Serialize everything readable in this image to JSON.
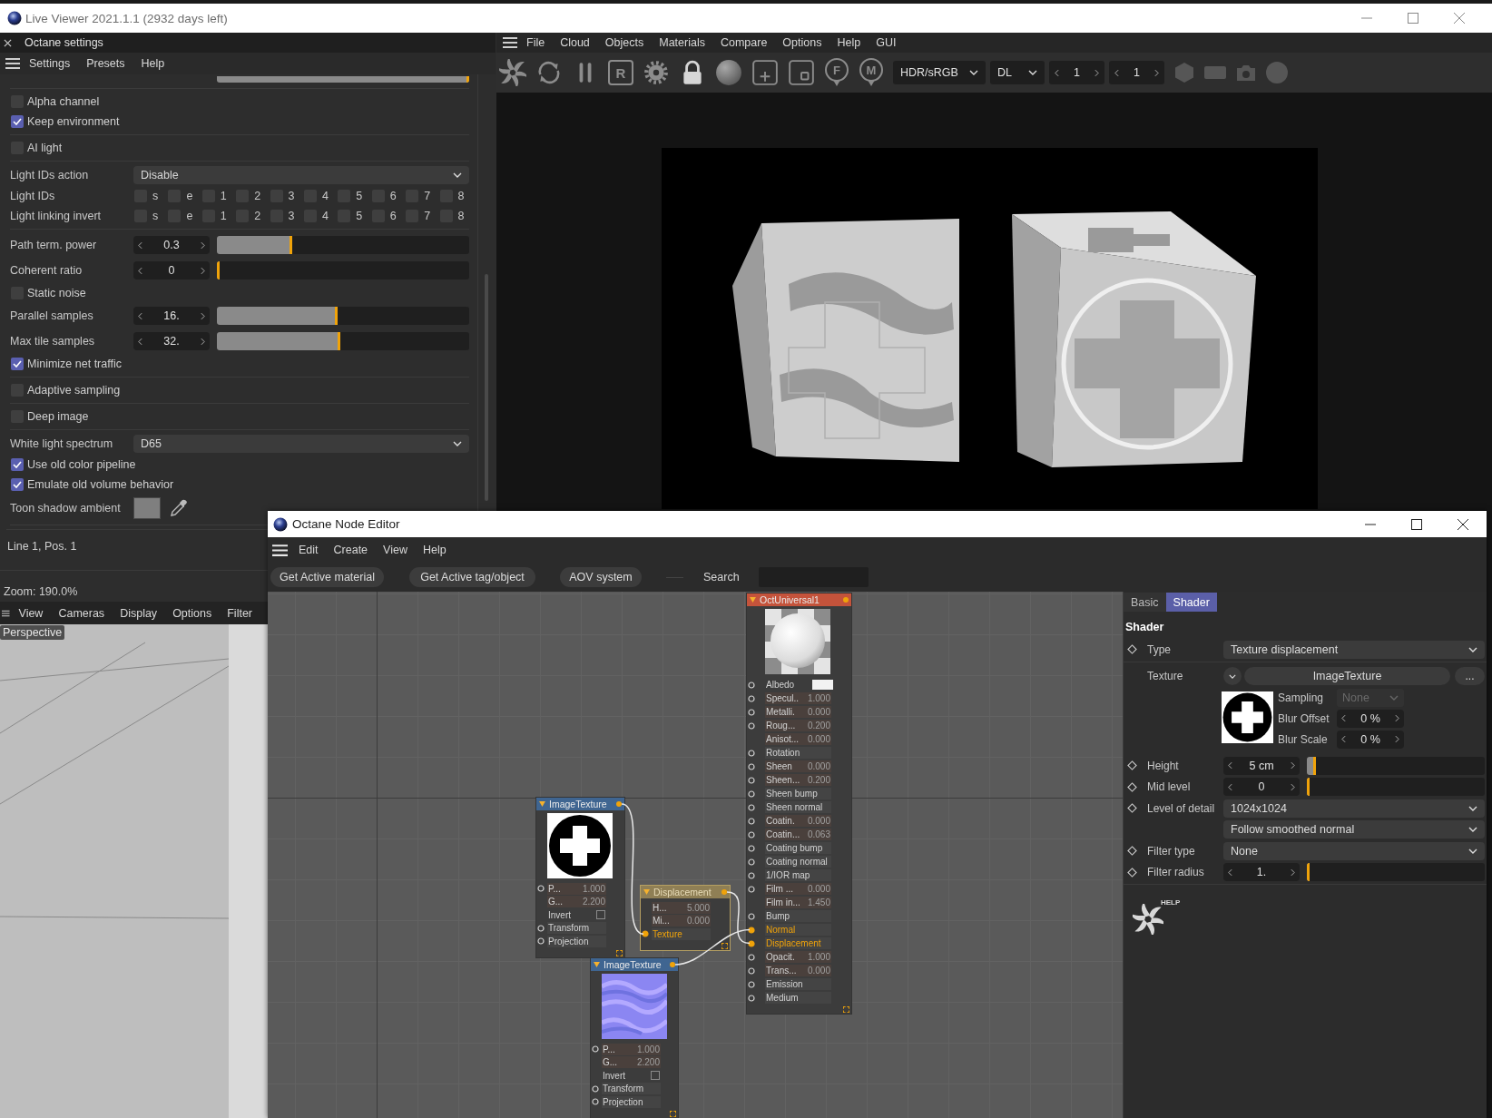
{
  "window": {
    "title": "Live Viewer 2021.1.1 (2932 days left)"
  },
  "settings": {
    "title": "Octane settings",
    "menu": [
      "Settings",
      "Presets",
      "Help"
    ],
    "partial_slider": {
      "level": 1
    },
    "groups": [
      [
        {
          "kind": "checkbox",
          "label": "Alpha channel",
          "checked": false
        },
        {
          "kind": "checkbox",
          "label": "Keep environment",
          "checked": true
        }
      ],
      [
        {
          "kind": "checkbox",
          "label": "AI light",
          "checked": false
        }
      ],
      [
        {
          "kind": "dropdown",
          "label": "Light IDs action",
          "value": "Disable"
        },
        {
          "kind": "checkgrid",
          "label": "Light IDs",
          "boxes": [
            {
              "label": "s",
              "checked": false
            },
            {
              "label": "e",
              "checked": false
            },
            {
              "label": "1",
              "checked": false
            },
            {
              "label": "2",
              "checked": false
            },
            {
              "label": "3",
              "checked": false
            },
            {
              "label": "4",
              "checked": false
            },
            {
              "label": "5",
              "checked": false
            },
            {
              "label": "6",
              "checked": false
            },
            {
              "label": "7",
              "checked": false
            },
            {
              "label": "8",
              "checked": false
            }
          ]
        },
        {
          "kind": "checkgrid",
          "label": "Light linking invert",
          "boxes": [
            {
              "label": "s",
              "checked": false
            },
            {
              "label": "e",
              "checked": false
            },
            {
              "label": "1",
              "checked": false
            },
            {
              "label": "2",
              "checked": false
            },
            {
              "label": "3",
              "checked": false
            },
            {
              "label": "4",
              "checked": false
            },
            {
              "label": "5",
              "checked": false
            },
            {
              "label": "6",
              "checked": false
            },
            {
              "label": "7",
              "checked": false
            },
            {
              "label": "8",
              "checked": false
            }
          ]
        }
      ],
      [
        {
          "kind": "slider",
          "label": "Path term. power",
          "value": "0.3",
          "level": 0.3
        },
        {
          "kind": "slider",
          "label": "Coherent ratio",
          "value": "0",
          "level": 0
        },
        {
          "kind": "checkbox",
          "label": "Static noise",
          "checked": false
        },
        {
          "kind": "slider",
          "label": "Parallel samples",
          "value": "16.",
          "level": 0.48
        },
        {
          "kind": "slider",
          "label": "Max tile samples",
          "value": "32.",
          "level": 0.49
        },
        {
          "kind": "checkbox",
          "label": "Minimize net traffic",
          "checked": true
        }
      ],
      [
        {
          "kind": "checkbox",
          "label": "Adaptive sampling",
          "checked": false
        }
      ],
      [
        {
          "kind": "checkbox",
          "label": "Deep image",
          "checked": false
        }
      ],
      [
        {
          "kind": "dropdown",
          "label": "White light spectrum",
          "value": "D65"
        },
        {
          "kind": "checkbox",
          "label": "Use old color pipeline",
          "checked": true
        },
        {
          "kind": "checkbox",
          "label": "Emulate old volume behavior",
          "checked": true
        },
        {
          "kind": "color",
          "label": "Toon shadow ambient",
          "color": "#7f7f7f"
        }
      ]
    ],
    "status": "Line 1, Pos. 1",
    "zoom": "Zoom: 190.0%"
  },
  "viewport": {
    "menu": [
      "View",
      "Cameras",
      "Display",
      "Options",
      "Filter"
    ],
    "label": "Perspective"
  },
  "viewer": {
    "menu": [
      "File",
      "Cloud",
      "Objects",
      "Materials",
      "Compare",
      "Options",
      "Help",
      "GUI"
    ],
    "toolbar": {
      "letter_key": "R",
      "pins": [
        "F",
        "M"
      ],
      "dropdowns": [
        "HDR/sRGB",
        "DL"
      ],
      "spinners": [
        "1",
        "1"
      ]
    }
  },
  "node_editor": {
    "title": "Octane Node Editor",
    "menu": [
      "Edit",
      "Create",
      "View",
      "Help"
    ],
    "buttons": [
      "Get Active material",
      "Get Active tag/object",
      "AOV system"
    ],
    "search_label": "Search",
    "nodes": [
      {
        "kind": "material",
        "title": "OctUniversal1",
        "preview": {
          "kind": "material_ball"
        },
        "selected": false,
        "rows": [
          {
            "kind": "color",
            "label": "Albedo",
            "port": true,
            "connected": false,
            "color": "#f2f2f2"
          },
          {
            "kind": "value",
            "label": "Specul..",
            "value": "1.000",
            "port": true,
            "connected": false
          },
          {
            "kind": "value",
            "label": "Metalli.",
            "value": "0.000",
            "port": true,
            "connected": false
          },
          {
            "kind": "value",
            "label": "Roug...",
            "value": "0.200",
            "port": true,
            "connected": false
          },
          {
            "kind": "value",
            "label": "Anisot...",
            "value": "0.000",
            "port": false,
            "connected": false
          },
          {
            "kind": "link",
            "label": "Rotation",
            "port": true,
            "connected": false
          },
          {
            "kind": "value",
            "label": "Sheen",
            "value": "0.000",
            "port": true,
            "connected": false
          },
          {
            "kind": "value",
            "label": "Sheen...",
            "value": "0.200",
            "port": true,
            "connected": false
          },
          {
            "kind": "link",
            "label": "Sheen bump",
            "port": true,
            "connected": false
          },
          {
            "kind": "link",
            "label": "Sheen normal",
            "port": true,
            "connected": false
          },
          {
            "kind": "value",
            "label": "Coatin.",
            "value": "0.000",
            "port": true,
            "connected": false
          },
          {
            "kind": "value",
            "label": "Coatin...",
            "value": "0.063",
            "port": true,
            "connected": false
          },
          {
            "kind": "link",
            "label": "Coating bump",
            "port": true,
            "connected": false
          },
          {
            "kind": "link",
            "label": "Coating normal",
            "port": true,
            "connected": false
          },
          {
            "kind": "link",
            "label": "1/IOR map",
            "port": true,
            "connected": false
          },
          {
            "kind": "value",
            "label": "Film ...",
            "value": "0.000",
            "port": true,
            "connected": false
          },
          {
            "kind": "value",
            "label": "Film in...",
            "value": "1.450",
            "port": false,
            "connected": false
          },
          {
            "kind": "link",
            "label": "Bump",
            "port": true,
            "connected": false
          },
          {
            "kind": "link",
            "label": "Normal",
            "port": true,
            "connected": true
          },
          {
            "kind": "link",
            "label": "Displacement",
            "port": true,
            "connected": true
          },
          {
            "kind": "value",
            "label": "Opacit.",
            "value": "1.000",
            "port": true,
            "connected": false
          },
          {
            "kind": "value",
            "label": "Trans...",
            "value": "0.000",
            "port": true,
            "connected": false
          },
          {
            "kind": "link",
            "label": "Emission",
            "port": true,
            "connected": false
          },
          {
            "kind": "link",
            "label": "Medium",
            "port": true,
            "connected": false
          }
        ]
      },
      {
        "kind": "texture",
        "title": "ImageTexture",
        "preview": {
          "kind": "cross_mark"
        },
        "selected": false,
        "rows": [
          {
            "kind": "value",
            "label": "P...",
            "value": "1.000",
            "port": true,
            "connected": false
          },
          {
            "kind": "value",
            "label": "G...",
            "value": "2.200",
            "port": false,
            "connected": false
          },
          {
            "kind": "checkbox",
            "label": "Invert",
            "port": false,
            "connected": false,
            "checked": false
          },
          {
            "kind": "link",
            "label": "Transform",
            "port": true,
            "connected": false
          },
          {
            "kind": "link",
            "label": "Projection",
            "port": true,
            "connected": false
          }
        ]
      },
      {
        "kind": "displacement",
        "title": "Displacement",
        "selected": true,
        "rows": [
          {
            "kind": "value",
            "label": "H...",
            "value": "5.000",
            "port": false,
            "connected": false
          },
          {
            "kind": "value",
            "label": "Mi...",
            "value": "0.000",
            "port": false,
            "connected": false
          },
          {
            "kind": "link",
            "label": "Texture",
            "port": true,
            "connected": true
          }
        ]
      },
      {
        "kind": "texture",
        "title": "ImageTexture",
        "preview": {
          "kind": "normal_map"
        },
        "selected": false,
        "rows": [
          {
            "kind": "value",
            "label": "P...",
            "value": "1.000",
            "port": true,
            "connected": false
          },
          {
            "kind": "value",
            "label": "G...",
            "value": "2.200",
            "port": false,
            "connected": false
          },
          {
            "kind": "checkbox",
            "label": "Invert",
            "port": false,
            "connected": false,
            "checked": false
          },
          {
            "kind": "link",
            "label": "Transform",
            "port": true,
            "connected": false
          },
          {
            "kind": "link",
            "label": "Projection",
            "port": true,
            "connected": false
          }
        ]
      }
    ],
    "properties": {
      "tabs": [
        {
          "label": "Basic",
          "selected": false
        },
        {
          "label": "Shader",
          "selected": true
        }
      ],
      "heading": "Shader",
      "groups": [
        [
          {
            "kind": "dropdown",
            "label": "Type",
            "keyframe": true,
            "value": "Texture displacement"
          }
        ],
        [
          {
            "kind": "texture",
            "label": "Texture",
            "keyframe": false,
            "value": "ImageTexture",
            "more": "...",
            "sampling": {
              "label": "Sampling",
              "value": "None",
              "disabled": true
            },
            "blur": [
              {
                "label": "Blur Offset",
                "value": "0 %"
              },
              {
                "label": "Blur Scale",
                "value": "0 %"
              }
            ]
          },
          {
            "kind": "slider",
            "label": "Height",
            "keyframe": true,
            "value": "5 cm",
            "level": 0.05
          },
          {
            "kind": "slider",
            "label": "Mid level",
            "keyframe": true,
            "value": "0",
            "level": 0
          },
          {
            "kind": "dropdown",
            "label": "Level of detail",
            "keyframe": true,
            "value": "1024x1024"
          },
          {
            "kind": "dropdown",
            "keyframe": false,
            "value": "Follow smoothed normal"
          },
          {
            "kind": "dropdown",
            "label": "Filter type",
            "keyframe": true,
            "value": "None"
          },
          {
            "kind": "slider",
            "label": "Filter radius",
            "keyframe": true,
            "value": "1.",
            "level": 0
          }
        ]
      ],
      "help": "HELP"
    }
  }
}
